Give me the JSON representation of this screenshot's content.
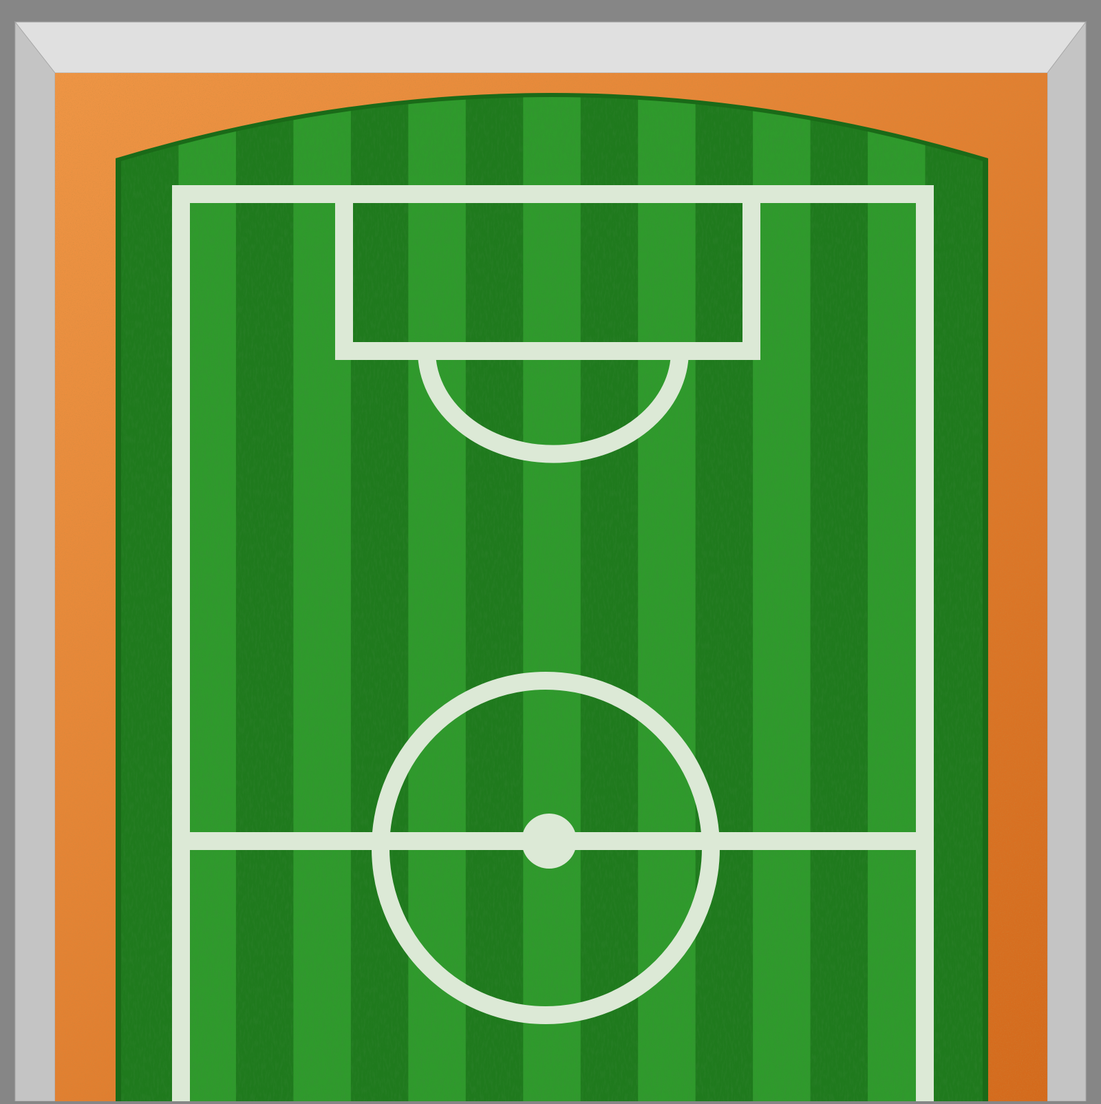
{
  "game": {
    "view": "soccer-pitch-top-down",
    "colors": {
      "background": "#868686",
      "frame_top": "#e0e0e0",
      "frame_side": "#c4c4c4",
      "frame_outline": "#a8a8a8",
      "track_light": "#ee9545",
      "track_dark": "#d46a1c",
      "grass_light": "#2f9a2c",
      "grass_dark": "#1f7a1d",
      "pitch_edge": "#1a6a18",
      "line": "#dce9d6"
    },
    "pitch": {
      "stripe_count": 15,
      "markings": [
        "touchlines",
        "goal-line",
        "penalty-box",
        "penalty-arc",
        "halfway-line",
        "center-circle",
        "center-spot"
      ]
    }
  }
}
